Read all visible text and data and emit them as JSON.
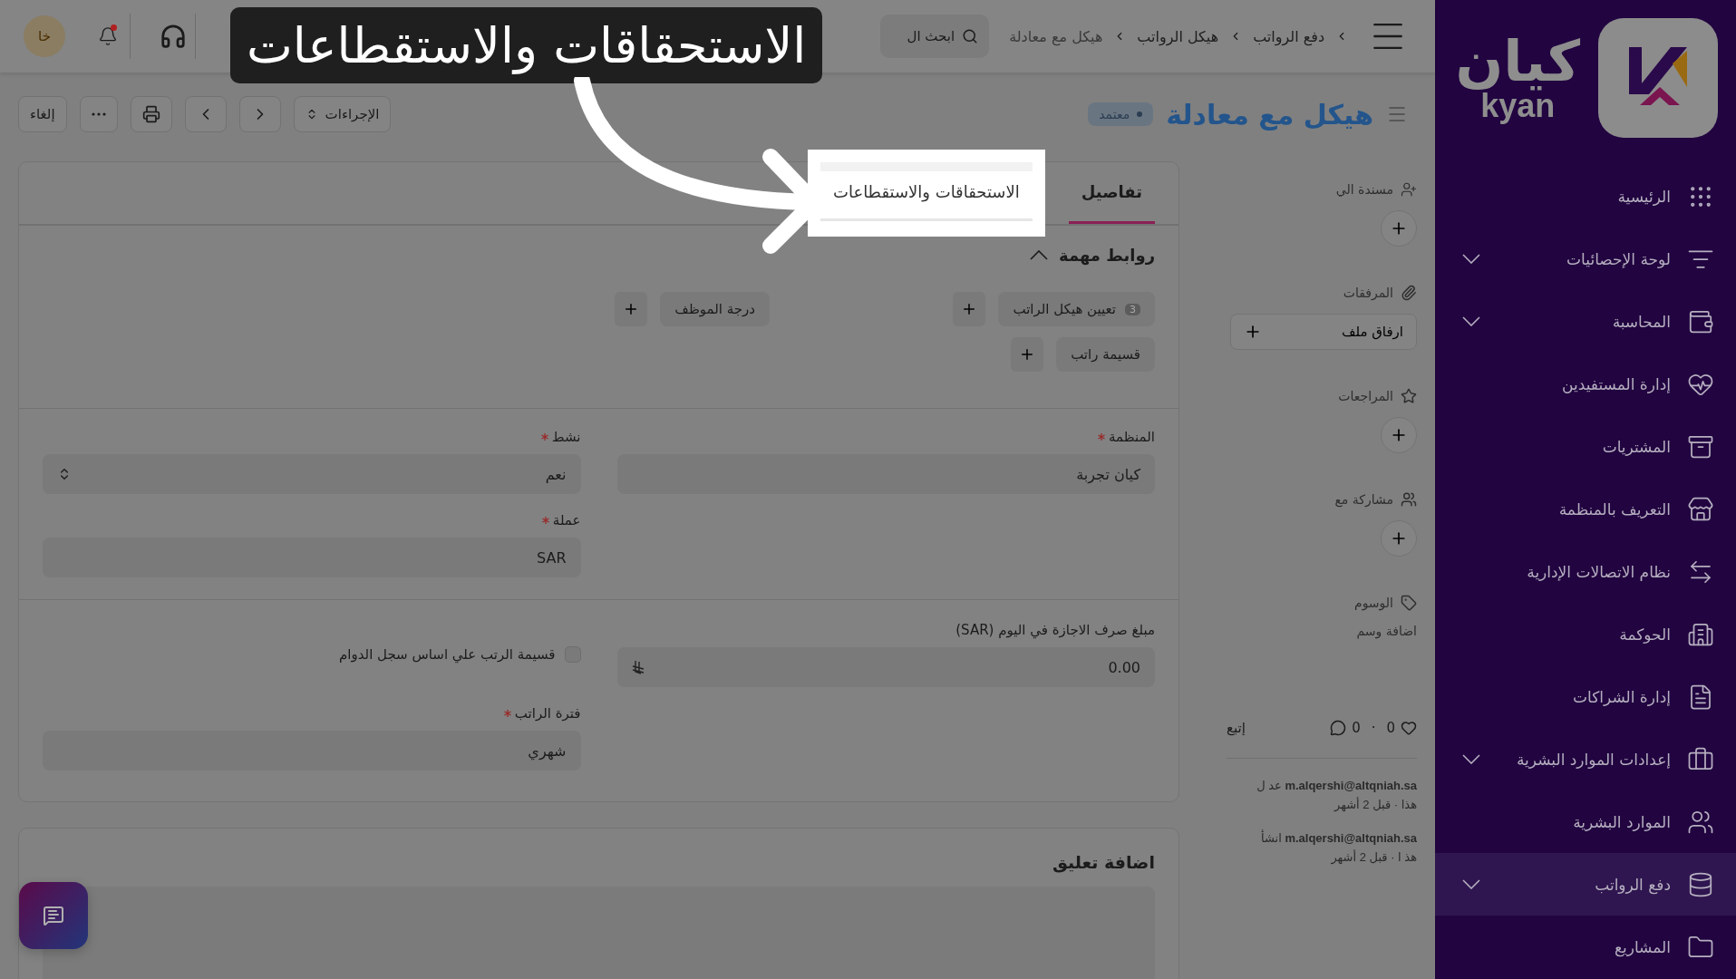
{
  "header": {
    "breadcrumbs": [
      "دفع الرواتب",
      "هيكل الرواتب",
      "هيكل مع معادلة"
    ],
    "search": {
      "placeholder": "ابحث ال"
    },
    "notification": true,
    "avatar": "خا"
  },
  "title_bar": {
    "title": "هيكل مع معادلة",
    "status": "معتمد",
    "actions_label": "الإجراءات",
    "cancel_label": "إلغاء"
  },
  "sidebar": {
    "logo_ar": "كيان",
    "logo_en": "kyan",
    "items": [
      {
        "label": "الرئيسية",
        "expandable": false,
        "selected": false
      },
      {
        "label": "لوحة الإحصائيات",
        "expandable": true,
        "selected": false
      },
      {
        "label": "المحاسبة",
        "expandable": true,
        "selected": false
      },
      {
        "label": "إدارة المستفيدين",
        "expandable": false,
        "selected": false
      },
      {
        "label": "المشتريات",
        "expandable": false,
        "selected": false
      },
      {
        "label": "التعريف بالمنظمة",
        "expandable": false,
        "selected": false
      },
      {
        "label": "نظام الاتصالات الإدارية",
        "expandable": false,
        "selected": false
      },
      {
        "label": "الحوكمة",
        "expandable": false,
        "selected": false
      },
      {
        "label": "إدارة الشراكات",
        "expandable": false,
        "selected": false
      },
      {
        "label": "إعدادات الموارد البشرية",
        "expandable": true,
        "selected": false
      },
      {
        "label": "الموارد البشرية",
        "expandable": false,
        "selected": false
      },
      {
        "label": "دفع الرواتب",
        "expandable": true,
        "selected": true
      },
      {
        "label": "المشاريع",
        "expandable": false,
        "selected": false
      }
    ]
  },
  "side_panel": {
    "assigned_to": "مسندة الي",
    "attachments": "المرفقات",
    "attach_button": "ارفاق ملف",
    "reviews": "المراجعات",
    "shared_with": "مشاركة مع",
    "tags": "الوسوم",
    "add_tag": "اضافة وسم",
    "likes": "0",
    "separator": "·",
    "comments": "0",
    "follow": "إتبع",
    "activity": [
      {
        "user": "m.alqershi@altqniah.sa",
        "action": "عد ل",
        "time": "هذا · قبل 2 أشهر"
      },
      {
        "user": "m.alqershi@altqniah.sa",
        "action": "انشأ",
        "time": "هذ ا · قبل 2 أشهر"
      }
    ]
  },
  "tabs": [
    {
      "label": "تفاصيل",
      "selected": true,
      "highlighted": false
    },
    {
      "label": "الاستحقاقات والاستقطاعات",
      "selected": false,
      "highlighted": true
    }
  ],
  "links_section": {
    "title": "روابط مهمة",
    "expanded": true,
    "links": [
      {
        "label": "تعيين هيكل الراتب",
        "count": "3"
      },
      {
        "label": "درجة الموظف"
      },
      {
        "label": "قسيمة راتب"
      }
    ]
  },
  "fields": [
    {
      "kind": "input",
      "label": "المنظمة",
      "required": true,
      "value": "كيان تجربة"
    },
    {
      "kind": "select",
      "label": "نشط",
      "required": true,
      "value": "نعم"
    },
    {
      "kind": "empty"
    },
    {
      "kind": "input",
      "label": "عملة",
      "required": true,
      "value": "SAR"
    },
    {
      "kind": "divider"
    },
    {
      "kind": "amount",
      "label": "مبلغ صرف الاجازة في اليوم (SAR)",
      "required": false,
      "value": "0.00"
    },
    {
      "kind": "checkbox",
      "label": "قسيمة الرتب علي اساس سجل الدوام",
      "checked": false
    },
    {
      "kind": "empty"
    },
    {
      "kind": "input",
      "label": "فترة الراتب",
      "required": true,
      "value": "شهري"
    }
  ],
  "comment": {
    "title": "اضافة تعليق"
  },
  "tour": {
    "caption": "الاستحقاقات والاستقطاعات"
  }
}
